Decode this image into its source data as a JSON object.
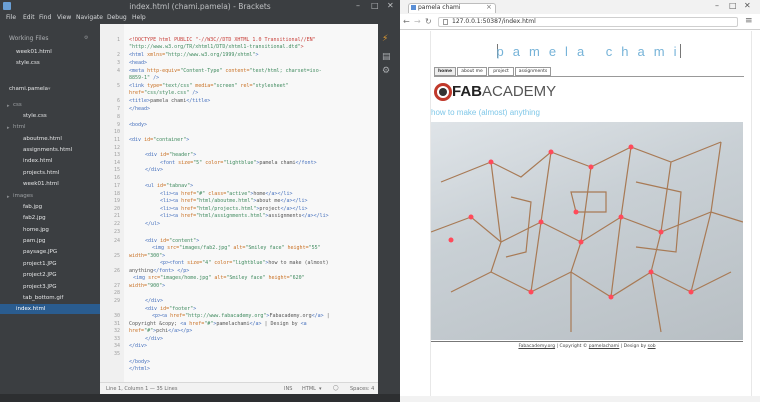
{
  "brackets": {
    "title": "index.html (chami.pamela) - Brackets",
    "menu": [
      "File",
      "Edit",
      "Find",
      "View",
      "Navigate",
      "Debug",
      "Help"
    ],
    "working_files_label": "Working Files",
    "working_files": [
      "week01.html",
      "style.css"
    ],
    "project_name": "chami.pamela",
    "tree": {
      "css_folder": "css",
      "css_files": [
        "style.css"
      ],
      "html_folder": "html",
      "html_files": [
        "aboutme.html",
        "assignments.html",
        "index.html",
        "projects.html",
        "week01.html"
      ],
      "images_folder": "images",
      "image_files": [
        "fab.jpg",
        "fab2.jpg",
        "home.jpg",
        "pam.jpg",
        "paysage.JPG",
        "project1.JPG",
        "project2.JPG",
        "project3.JPG",
        "tab_bottom.gif"
      ],
      "selected_file": "index.html"
    },
    "line_numbers": [
      "1",
      "",
      "2",
      "3",
      "4",
      "",
      "5",
      "",
      "6",
      "7",
      "8",
      "9",
      "10",
      "11",
      "12",
      "13",
      "14",
      "15",
      "16",
      "17",
      "18",
      "19",
      "20",
      "21",
      "22",
      "23",
      "24",
      "",
      "25",
      "",
      "26",
      "",
      "27",
      "28",
      "29",
      "",
      "30",
      "31",
      "32",
      "33",
      "34",
      "35"
    ],
    "status": {
      "cursor": "Line 1, Column 1 — 35 Lines",
      "mode": "INS",
      "language": "HTML",
      "spaces": "Spaces: 4"
    }
  },
  "chrome": {
    "tab_title": "pamela chami",
    "url": "127.0.0.1:50387/index.html"
  },
  "site": {
    "title": "pamela chami",
    "tabs": [
      "home",
      "about me",
      "project",
      "assignments"
    ],
    "logo_text_a": "FAB",
    "logo_text_b": "ACADEMY",
    "tagline": "how to make (almost) anything",
    "footer": {
      "link1": "Fabacademy.org",
      "text1": " | Copyright © ",
      "link2": "pamelachami",
      "text2": " | Design by ",
      "link3": "sob"
    }
  }
}
